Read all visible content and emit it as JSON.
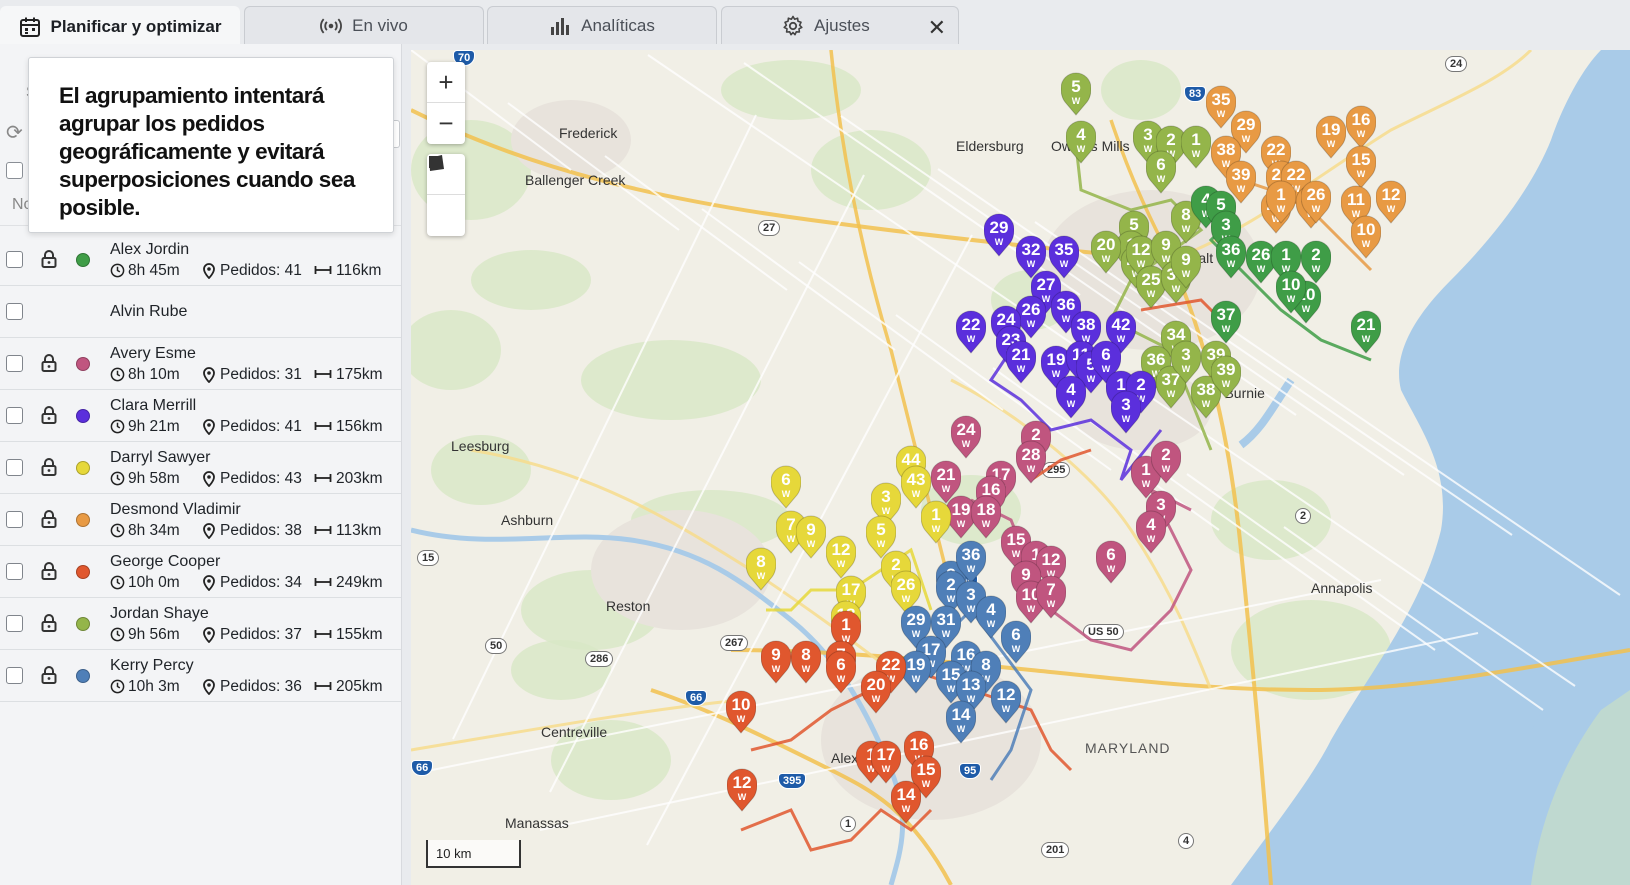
{
  "tabs": [
    {
      "label": "Planificar y optimizar",
      "icon": "calendar-icon",
      "active": true
    },
    {
      "label": "En vivo",
      "icon": "broadcast-icon",
      "active": false
    },
    {
      "label": "Analíticas",
      "icon": "bar-chart-icon",
      "active": false
    },
    {
      "label": "Ajustes",
      "icon": "gear-icon",
      "active": false
    }
  ],
  "tooltip": {
    "text": "El agrupamiento intentará agrupar los pedidos geográficamente y evitará superposiciones cuando sea posible."
  },
  "sidebar": {
    "ghost_letter_1": "S",
    "ghost_letter_2": "Nc"
  },
  "drivers": [
    {
      "name": "Alex Jordin",
      "color": "#3f9d47",
      "duration": "8h 45m",
      "orders": "Pedidos: 41",
      "distance": "116km"
    },
    {
      "name": "Alvin Rube",
      "color": "",
      "duration": "",
      "orders": "",
      "distance": ""
    },
    {
      "name": "Avery Esme",
      "color": "#c0557f",
      "duration": "8h 10m",
      "orders": "Pedidos: 31",
      "distance": "175km"
    },
    {
      "name": "Clara Merrill",
      "color": "#5b2fdc",
      "duration": "9h 21m",
      "orders": "Pedidos: 41",
      "distance": "156km"
    },
    {
      "name": "Darryl Sawyer",
      "color": "#e6d83a",
      "duration": "9h 58m",
      "orders": "Pedidos: 43",
      "distance": "203km"
    },
    {
      "name": "Desmond Vladimir",
      "color": "#e89a44",
      "duration": "8h 34m",
      "orders": "Pedidos: 38",
      "distance": "113km"
    },
    {
      "name": "George Cooper",
      "color": "#e0572e",
      "duration": "10h 0m",
      "orders": "Pedidos: 34",
      "distance": "249km"
    },
    {
      "name": "Jordan Shaye",
      "color": "#94b54a",
      "duration": "9h 56m",
      "orders": "Pedidos: 37",
      "distance": "155km"
    },
    {
      "name": "Kerry Percy",
      "color": "#4f7fb8",
      "duration": "10h 3m",
      "orders": "Pedidos: 36",
      "distance": "205km"
    }
  ],
  "map": {
    "zoom_in": "+",
    "zoom_out": "−",
    "scale_label": "10 km",
    "places": [
      {
        "name": "Frederick"
      },
      {
        "name": "Eldersburg"
      },
      {
        "name": "Owings Mills"
      },
      {
        "name": "Ballenger Creek"
      },
      {
        "name": "Leesburg"
      },
      {
        "name": "Ashburn"
      },
      {
        "name": "Reston"
      },
      {
        "name": "Centreville"
      },
      {
        "name": "Manassas"
      },
      {
        "name": "Annapolis"
      },
      {
        "name": "MARYLAND"
      },
      {
        "name": "Balt"
      },
      {
        "name": "Dun"
      },
      {
        "name": "Glen Burnie"
      },
      {
        "name": "Alexandria"
      }
    ],
    "shields": [
      "70",
      "83",
      "24",
      "27",
      "295",
      "2",
      "15",
      "95",
      "267",
      "50",
      "286",
      "66",
      "395",
      "1",
      "US 50",
      "66",
      "4",
      "201",
      "95"
    ],
    "marker_unit": "W",
    "markers": {
      "olive": [
        "5",
        "4",
        "3",
        "2",
        "1",
        "6",
        "8",
        "5",
        "1",
        "20",
        "22",
        "12",
        "9",
        "25",
        "30",
        "9",
        "34",
        "36",
        "37",
        "3",
        "39",
        "38",
        "39"
      ],
      "orange": [
        "35",
        "29",
        "22",
        "19",
        "16",
        "38",
        "24",
        "22",
        "15",
        "39",
        "23",
        "1",
        "4",
        "11",
        "12",
        "10",
        "26"
      ],
      "green": [
        "4",
        "5",
        "3",
        "36",
        "26",
        "2",
        "1",
        "20",
        "21",
        "37",
        "10"
      ],
      "purple": [
        "29",
        "32",
        "35",
        "27",
        "36",
        "26",
        "24",
        "38",
        "42",
        "23",
        "21",
        "19",
        "11",
        "5",
        "6",
        "22",
        "4",
        "1",
        "2",
        "3"
      ],
      "pink": [
        "24",
        "2",
        "28",
        "21",
        "17",
        "16",
        "19",
        "18",
        "1",
        "2",
        "3",
        "4",
        "15",
        "1",
        "12",
        "9",
        "10",
        "7",
        "6"
      ],
      "yellow": [
        "44",
        "43",
        "6",
        "3",
        "1",
        "7",
        "9",
        "5",
        "8",
        "12",
        "2",
        "17",
        "26",
        "18"
      ],
      "blue": [
        "3",
        "36",
        "2",
        "3",
        "29",
        "31",
        "4",
        "17",
        "6",
        "16",
        "8",
        "19",
        "15",
        "13",
        "12",
        "14"
      ],
      "red": [
        "1",
        "7",
        "22",
        "9",
        "8",
        "6",
        "20",
        "10",
        "12",
        "1",
        "17",
        "16",
        "15",
        "14"
      ]
    }
  }
}
